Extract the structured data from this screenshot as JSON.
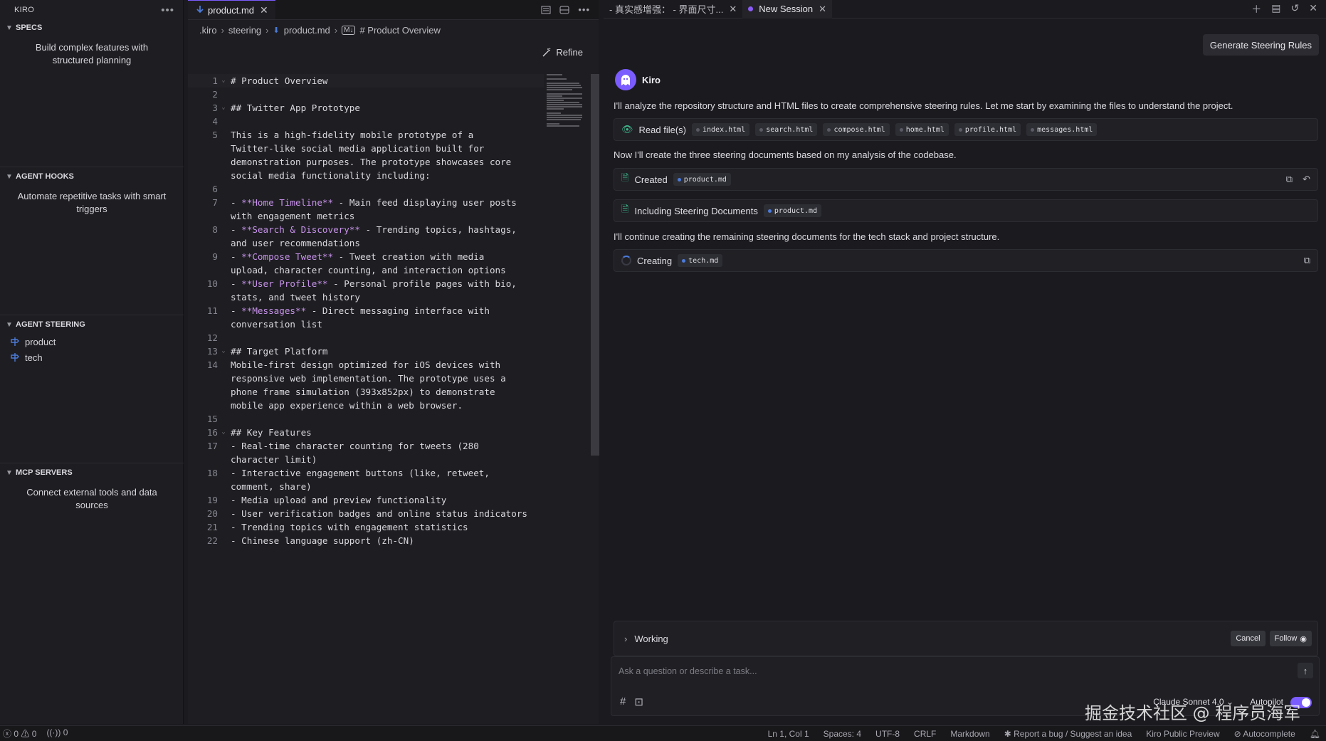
{
  "sidebar": {
    "title": "KIRO",
    "specs": {
      "title": "SPECS",
      "description": "Build complex features with structured planning"
    },
    "hooks": {
      "title": "AGENT HOOKS",
      "description": "Automate repetitive tasks with smart triggers"
    },
    "steering": {
      "title": "AGENT STEERING",
      "items": [
        "product",
        "tech"
      ]
    },
    "mcp": {
      "title": "MCP SERVERS",
      "description": "Connect external tools and data sources"
    }
  },
  "editor": {
    "tab": "product.md",
    "breadcrumbs": [
      ".kiro",
      "steering",
      "product.md",
      "# Product Overview"
    ],
    "refine": "Refine",
    "lines": [
      {
        "n": "1",
        "segs": [
          {
            "t": "# Product Overview"
          }
        ],
        "fold": true,
        "hl": true
      },
      {
        "n": "2",
        "segs": [
          {
            "t": ""
          }
        ]
      },
      {
        "n": "3",
        "segs": [
          {
            "t": "## Twitter App Prototype"
          }
        ],
        "fold": true
      },
      {
        "n": "4",
        "segs": [
          {
            "t": ""
          }
        ]
      },
      {
        "n": "5",
        "segs": [
          {
            "t": "This is a high-fidelity mobile prototype of a"
          }
        ]
      },
      {
        "n": "",
        "segs": [
          {
            "t": "Twitter-like social media application built for"
          }
        ]
      },
      {
        "n": "",
        "segs": [
          {
            "t": "demonstration purposes. The prototype showcases core"
          }
        ]
      },
      {
        "n": "",
        "segs": [
          {
            "t": "social media functionality including:"
          }
        ]
      },
      {
        "n": "6",
        "segs": [
          {
            "t": ""
          }
        ]
      },
      {
        "n": "7",
        "segs": [
          {
            "t": "- "
          },
          {
            "t": "**Home Timeline**",
            "b": true
          },
          {
            "t": " - Main feed displaying user posts"
          }
        ]
      },
      {
        "n": "",
        "segs": [
          {
            "t": "with engagement metrics"
          }
        ]
      },
      {
        "n": "8",
        "segs": [
          {
            "t": "- "
          },
          {
            "t": "**Search & Discovery**",
            "b": true
          },
          {
            "t": " - Trending topics, hashtags,"
          }
        ]
      },
      {
        "n": "",
        "segs": [
          {
            "t": "and user recommendations"
          }
        ]
      },
      {
        "n": "9",
        "segs": [
          {
            "t": "- "
          },
          {
            "t": "**Compose Tweet**",
            "b": true
          },
          {
            "t": " - Tweet creation with media"
          }
        ]
      },
      {
        "n": "",
        "segs": [
          {
            "t": "upload, character counting, and interaction options"
          }
        ]
      },
      {
        "n": "10",
        "segs": [
          {
            "t": "- "
          },
          {
            "t": "**User Profile**",
            "b": true
          },
          {
            "t": " - Personal profile pages with bio,"
          }
        ]
      },
      {
        "n": "",
        "segs": [
          {
            "t": "stats, and tweet history"
          }
        ]
      },
      {
        "n": "11",
        "segs": [
          {
            "t": "- "
          },
          {
            "t": "**Messages**",
            "b": true
          },
          {
            "t": " - Direct messaging interface with"
          }
        ]
      },
      {
        "n": "",
        "segs": [
          {
            "t": "conversation list"
          }
        ]
      },
      {
        "n": "12",
        "segs": [
          {
            "t": ""
          }
        ]
      },
      {
        "n": "13",
        "segs": [
          {
            "t": "## Target Platform"
          }
        ],
        "fold": true
      },
      {
        "n": "14",
        "segs": [
          {
            "t": "Mobile-first design optimized for iOS devices with"
          }
        ]
      },
      {
        "n": "",
        "segs": [
          {
            "t": "responsive web implementation. The prototype uses a"
          }
        ]
      },
      {
        "n": "",
        "segs": [
          {
            "t": "phone frame simulation (393x852px) to demonstrate"
          }
        ]
      },
      {
        "n": "",
        "segs": [
          {
            "t": "mobile app experience within a web browser."
          }
        ]
      },
      {
        "n": "15",
        "segs": [
          {
            "t": ""
          }
        ]
      },
      {
        "n": "16",
        "segs": [
          {
            "t": "## Key Features"
          }
        ],
        "fold": true
      },
      {
        "n": "17",
        "segs": [
          {
            "t": "- Real-time character counting for tweets (280"
          }
        ]
      },
      {
        "n": "",
        "segs": [
          {
            "t": "character limit)"
          }
        ]
      },
      {
        "n": "18",
        "segs": [
          {
            "t": "- Interactive engagement buttons (like, retweet,"
          }
        ]
      },
      {
        "n": "",
        "segs": [
          {
            "t": "comment, share)"
          }
        ]
      },
      {
        "n": "19",
        "segs": [
          {
            "t": "- Media upload and preview functionality"
          }
        ]
      },
      {
        "n": "20",
        "segs": [
          {
            "t": "- User verification badges and online status indicators"
          }
        ]
      },
      {
        "n": "21",
        "segs": [
          {
            "t": "- Trending topics with engagement statistics"
          }
        ]
      },
      {
        "n": "22",
        "segs": [
          {
            "t": "- Chinese language support (zh-CN)"
          }
        ]
      }
    ]
  },
  "chat": {
    "tabs": [
      {
        "label": "- 真实感增强： - 界面尺寸...",
        "active": false
      },
      {
        "label": "New Session",
        "active": true
      }
    ],
    "generate_button": "Generate Steering Rules",
    "agent_name": "Kiro",
    "msg1": "I'll analyze the repository structure and HTML files to create comprehensive steering rules. Let me start by examining the files to understand the project.",
    "read_card": {
      "label": "Read file(s)",
      "files": [
        "index.html",
        "search.html",
        "compose.html",
        "home.html",
        "profile.html",
        "messages.html"
      ]
    },
    "msg2": "Now I'll create the three steering documents based on my analysis of the codebase.",
    "created_card": {
      "label": "Created",
      "file": "product.md"
    },
    "including_card": {
      "label": "Including Steering Documents",
      "file": "product.md"
    },
    "msg3": "I'll continue creating the remaining steering documents for the tech stack and project structure.",
    "creating_card": {
      "label": "Creating",
      "file": "tech.md"
    },
    "working": {
      "label": "Working",
      "cancel": "Cancel",
      "follow": "Follow"
    },
    "input": {
      "placeholder": "Ask a question or describe a task...",
      "model": "Claude Sonnet 4.0",
      "autopilot": "Autopilot"
    },
    "watermark": "掘金技术社区 @ 程序员海军"
  },
  "status": {
    "errors": "0",
    "warnings": "0",
    "ports": "0",
    "cursor": "Ln 1, Col 1",
    "spaces": "Spaces: 4",
    "encoding": "UTF-8",
    "eol": "CRLF",
    "language": "Markdown",
    "report": "Report a bug / Suggest an idea",
    "preview": "Kiro Public Preview",
    "autocomplete": "Autocomplete"
  },
  "colors": {
    "accent": "#7b5cff",
    "bold_markdown": "#c792ea",
    "md_file": "#4c7bd9"
  }
}
